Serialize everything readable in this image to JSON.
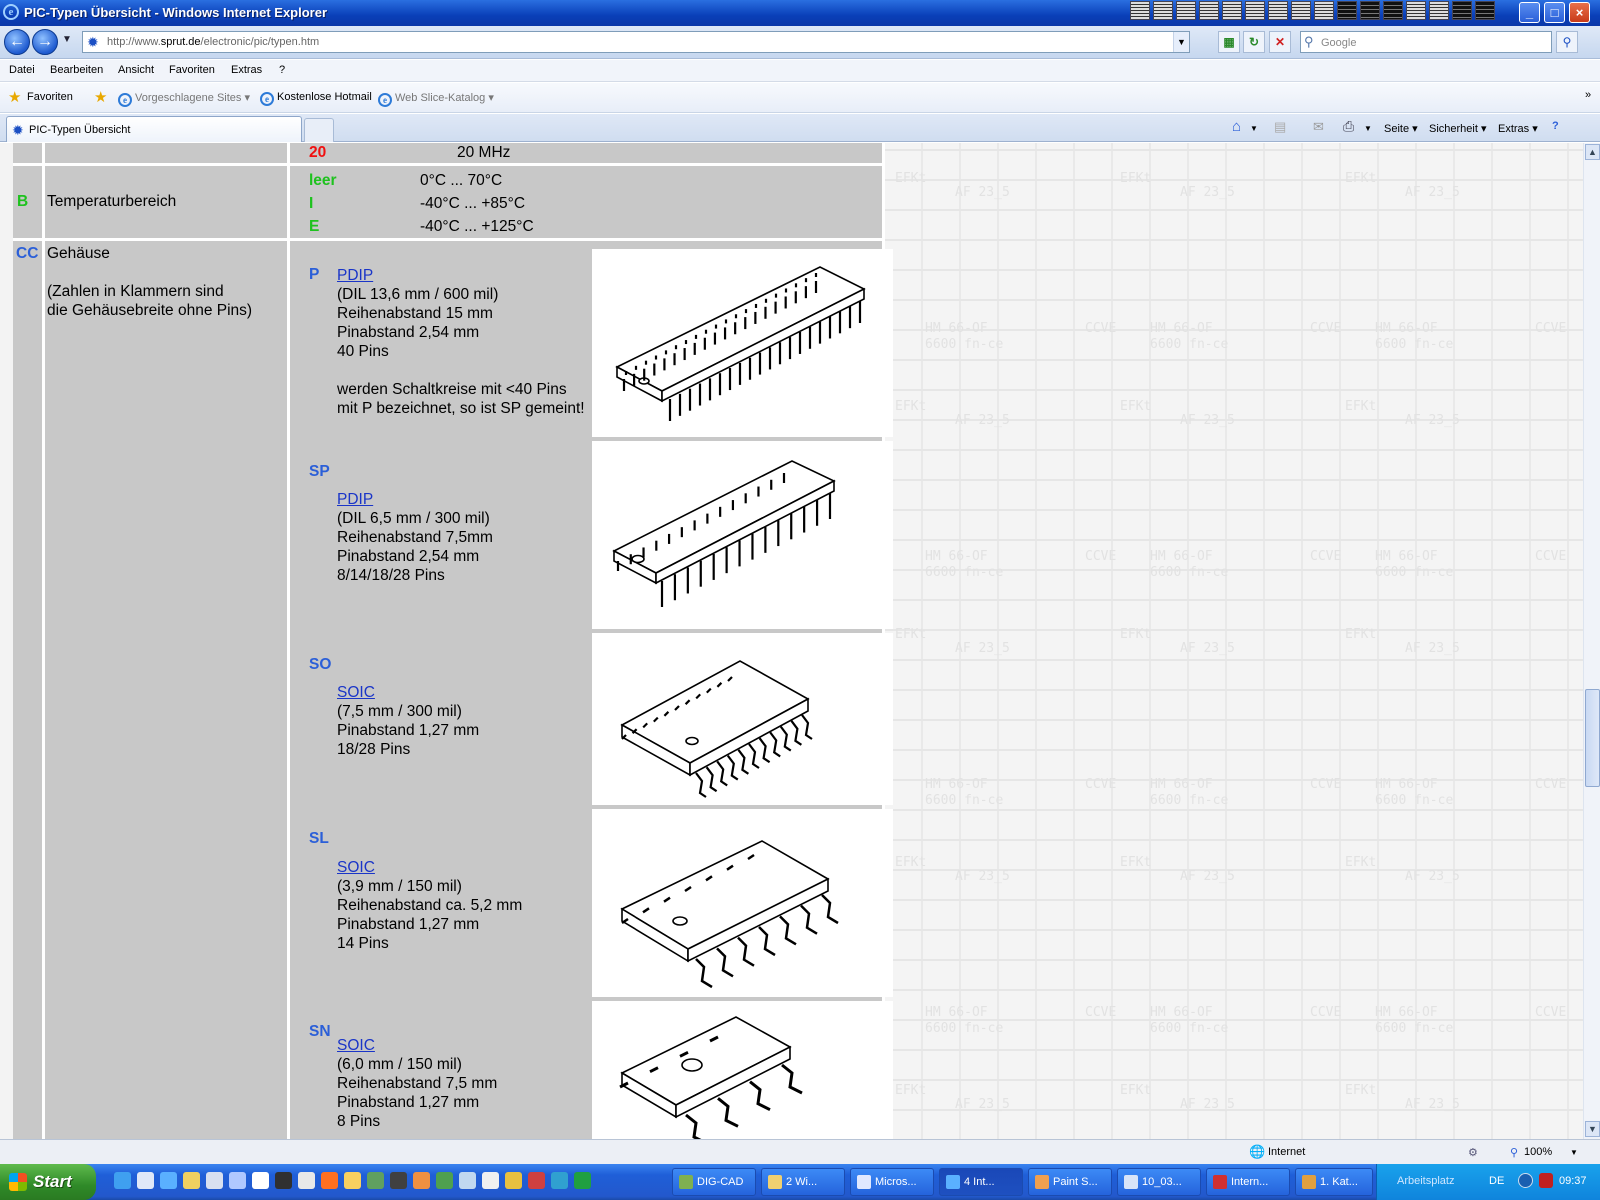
{
  "window": {
    "title": "PIC-Typen Übersicht - Windows Internet Explorer",
    "controls": {
      "minimize": "_",
      "maximize": "□",
      "close": "×"
    }
  },
  "address": {
    "url_prefix": "http://www.",
    "url_domain": "sprut.de",
    "url_path": "/electronic/pic/typen.htm",
    "search_placeholder": "Google"
  },
  "menu": [
    "Datei",
    "Bearbeiten",
    "Ansicht",
    "Favoriten",
    "Extras",
    "?"
  ],
  "favorites_bar": {
    "favorites_label": "Favoriten",
    "items": [
      "Vorgeschlagene Sites ▾",
      "Kostenlose Hotmail",
      "Web Slice-Katalog ▾"
    ]
  },
  "tab": {
    "label": "PIC-Typen Übersicht"
  },
  "command_bar": [
    "Seite ▾",
    "Sicherheit ▾",
    "Extras ▾"
  ],
  "table": {
    "speed_row": {
      "code": "20",
      "value": "20 MHz"
    },
    "temp_row": {
      "key": "B",
      "label": "Temperaturbereich",
      "options": [
        {
          "code": "leer",
          "range": "0°C ... 70°C"
        },
        {
          "code": "I",
          "range": "-40°C ... +85°C"
        },
        {
          "code": "E",
          "range": "-40°C ... +125°C"
        }
      ]
    },
    "package_row": {
      "key": "CC",
      "label": "Gehäuse",
      "note_line1": "(Zahlen in Klammern sind",
      "note_line2": "die Gehäusebreite ohne Pins)",
      "packages": [
        {
          "code": "P",
          "link": "PDIP",
          "lines": [
            "(DIL 13,6 mm / 600 mil)",
            "Reihenabstand 15 mm",
            "Pinabstand 2,54 mm",
            "40 Pins",
            "",
            "werden Schaltkreise mit <40 Pins",
            "mit P bezeichnet, so ist SP gemeint!"
          ]
        },
        {
          "code": "SP",
          "link": "PDIP",
          "lines": [
            "(DIL 6,5 mm / 300 mil)",
            "Reihenabstand 7,5mm",
            "Pinabstand 2,54 mm",
            "8/14/18/28 Pins"
          ]
        },
        {
          "code": "SO",
          "link": "SOIC",
          "lines": [
            "(7,5 mm / 300 mil)",
            "Pinabstand 1,27 mm",
            "18/28 Pins"
          ]
        },
        {
          "code": "SL",
          "link": "SOIC",
          "lines": [
            "(3,9 mm / 150 mil)",
            "Reihenabstand ca. 5,2 mm",
            "Pinabstand 1,27 mm",
            "14 Pins"
          ]
        },
        {
          "code": "SN",
          "link": "SOIC",
          "lines": [
            "(6,0 mm / 150 mil)",
            "Reihenabstand 7,5 mm",
            "Pinabstand 1,27 mm",
            "8 Pins"
          ]
        }
      ]
    }
  },
  "status": {
    "zone": "Internet",
    "zoom": "100%"
  },
  "taskbar": {
    "start": "Start",
    "buttons": [
      "DIG-CAD",
      "2 Wi...",
      "Micros...",
      "4 Int...",
      "Paint S...",
      "10_03...",
      "Intern...",
      "1. Kat..."
    ],
    "tray_label": "Arbeitsplatz",
    "lang": "DE",
    "clock": "09:37"
  },
  "colors": {
    "code_blue": "#2b5fd8",
    "code_green": "#1ec21e",
    "code_red": "#f01010",
    "cell_gray": "#c8c8c8",
    "link": "#1a35c8"
  }
}
